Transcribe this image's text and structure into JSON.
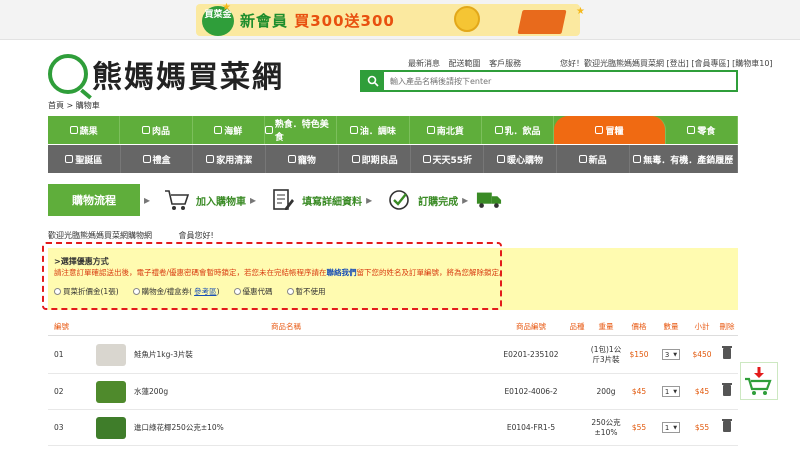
{
  "banner": {
    "badge": "買菜金",
    "promo_part1": "新會員",
    "promo_part2": "買300送300"
  },
  "header": {
    "logo_text": "熊媽媽買菜網",
    "top_links": [
      "最新消息",
      "配送範圍",
      "客戶服務"
    ],
    "user_bar": "您好！歡迎光臨熊媽媽買菜網 [登出] [會員專區] [購物車10]",
    "search_placeholder": "輸入產品名稱後請按下enter"
  },
  "breadcrumb": "首頁 > 購物車",
  "nav_primary": [
    {
      "label": "蔬果",
      "active": false
    },
    {
      "label": "肉品",
      "active": false
    },
    {
      "label": "海鮮",
      "active": false
    },
    {
      "label": "熟食．特色美食",
      "active": false
    },
    {
      "label": "油．調味",
      "active": false
    },
    {
      "label": "南北貨",
      "active": false
    },
    {
      "label": "乳．飲品",
      "active": false
    },
    {
      "label": "冒糧",
      "active": true
    },
    {
      "label": "零食",
      "active": false
    }
  ],
  "nav_secondary": [
    {
      "label": "聖誕區"
    },
    {
      "label": "禮盒"
    },
    {
      "label": "家用清潔"
    },
    {
      "label": "寵物"
    },
    {
      "label": "即期良品"
    },
    {
      "label": "天天55折"
    },
    {
      "label": "暖心購物"
    },
    {
      "label": "新品"
    },
    {
      "label": "無毒．有機．產銷履歷"
    }
  ],
  "process": {
    "title": "購物流程",
    "steps": [
      "加入購物車",
      "填寫詳細資料",
      "訂購完成"
    ]
  },
  "welcome": {
    "line1": "歡迎光臨熊媽媽買菜網購物網",
    "line2": "會員您好!"
  },
  "discount": {
    "heading": ">選擇優惠方式",
    "note_before": "請注意訂單確認送出後，電子禮卷/優惠密碼會暫時鎖定，若您未在完結帳程序請在",
    "note_link": "聯絡我們",
    "note_after": "留下您的姓名及訂單編號，將為您解除鎖定。",
    "options": [
      {
        "label": "買菜折價金(1張)",
        "link": ""
      },
      {
        "label": "購物金/禮盒券(",
        "link": "參考區",
        "after": ")"
      },
      {
        "label": "優惠代碼",
        "link": ""
      },
      {
        "label": "暫不使用",
        "link": ""
      }
    ]
  },
  "cart": {
    "headers": {
      "no": "編號",
      "name": "商品名稱",
      "code": "商品編號",
      "spec": "品種",
      "weight": "重量",
      "price": "價格",
      "qty": "數量",
      "subtotal": "小計",
      "delete": "刪除"
    },
    "rows": [
      {
        "no": "01",
        "name": "鮭魚片1kg-3片裝",
        "code": "E0201-235102",
        "weight": "(1包)1公斤3片裝",
        "price": "$150",
        "qty": "3",
        "subtotal": "$450",
        "thumb_color": "#d9d6cf"
      },
      {
        "no": "02",
        "name": "水蓮200g",
        "code": "E0102-4006-2",
        "weight": "200g",
        "price": "$45",
        "qty": "1",
        "subtotal": "$45",
        "thumb_color": "#4f8a2c"
      },
      {
        "no": "03",
        "name": "進口綠花椰250公克±10%",
        "code": "E0104-FR1-5",
        "weight": "250公克±10%",
        "price": "$55",
        "qty": "1",
        "subtotal": "$55",
        "thumb_color": "#3f7d2a"
      }
    ]
  },
  "colors": {
    "brand_green": "#5fae3b",
    "accent_orange": "#f06a12",
    "dark_nav": "#666666",
    "highlight_red": "#e31b1b"
  }
}
